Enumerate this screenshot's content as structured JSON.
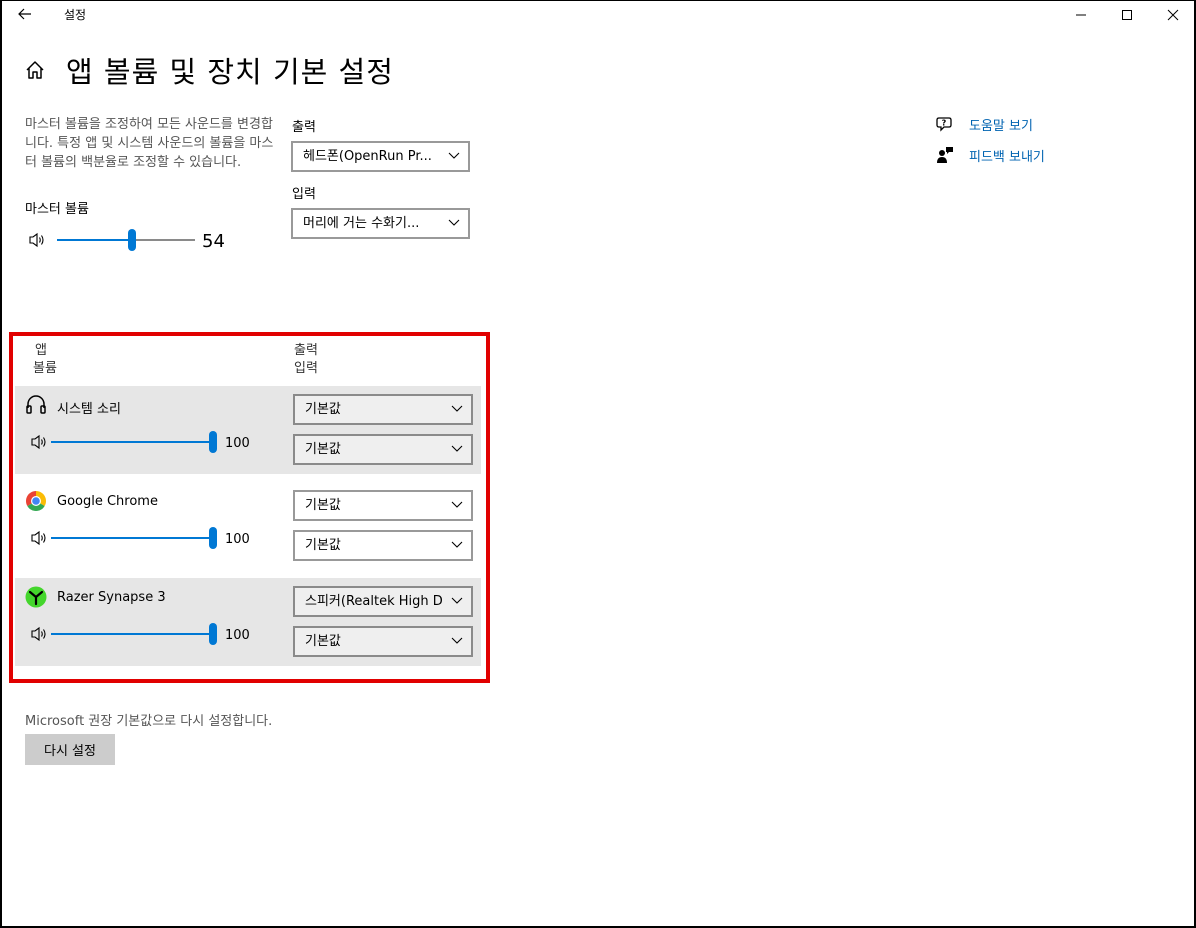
{
  "window": {
    "title": "설정",
    "minimize_glyph": "—",
    "close_glyph": "✕"
  },
  "page": {
    "title": "앱 볼륨 및 장치 기본 설정"
  },
  "master": {
    "description": "마스터 볼륨을 조정하여 모든 사운드를 변경합니다. 특정 앱 및 시스템 사운드의 볼륨을 마스터 볼륨의 백분율로 조정할 수 있습니다.",
    "label": "마스터 볼륨",
    "value": "54",
    "level": 0.54
  },
  "output": {
    "label": "출력",
    "selected": "헤드폰(OpenRun Pr..."
  },
  "input": {
    "label": "입력",
    "selected": "머리에 거는 수화기..."
  },
  "app_table": {
    "col_app": "앱",
    "col_volume": "볼륨",
    "col_output": "출력",
    "col_input": "입력",
    "rows": [
      {
        "name": "시스템 소리",
        "icon": "headphones-icon",
        "volume": "100",
        "level": 1.0,
        "output": "기본값",
        "input": "기본값"
      },
      {
        "name": "Google Chrome",
        "icon": "chrome-icon",
        "volume": "100",
        "level": 1.0,
        "output": "기본값",
        "input": "기본값"
      },
      {
        "name": "Razer Synapse 3",
        "icon": "razer-icon",
        "volume": "100",
        "level": 1.0,
        "output": "스피커(Realtek High D",
        "input": "기본값"
      }
    ]
  },
  "help": {
    "get_help": "도움말 보기",
    "feedback": "피드백 보내기"
  },
  "reset": {
    "text": "Microsoft 권장 기본값으로 다시 설정합니다.",
    "button": "다시 설정"
  },
  "colors": {
    "accent": "#0078d4",
    "highlight": "#e10000",
    "link": "#0063b1"
  }
}
